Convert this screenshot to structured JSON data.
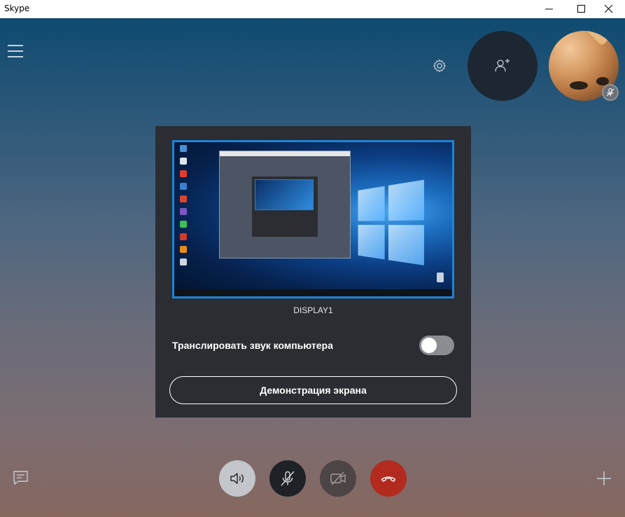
{
  "window": {
    "title": "Skype"
  },
  "share_panel": {
    "display_name": "DISPLAY1",
    "audio_label": "Транслировать звук компьютера",
    "audio_toggle_on": false,
    "share_button_label": "Демонстрация экрана"
  },
  "colors": {
    "accent_blue": "#1b84d8",
    "hangup_red": "#b32a1f",
    "panel_bg": "#2b2d33"
  },
  "controls": {
    "speaker_icon": "speaker-icon",
    "mic_icon": "mic-muted-icon",
    "video_icon": "video-off-icon",
    "hangup_icon": "hangup-icon"
  }
}
